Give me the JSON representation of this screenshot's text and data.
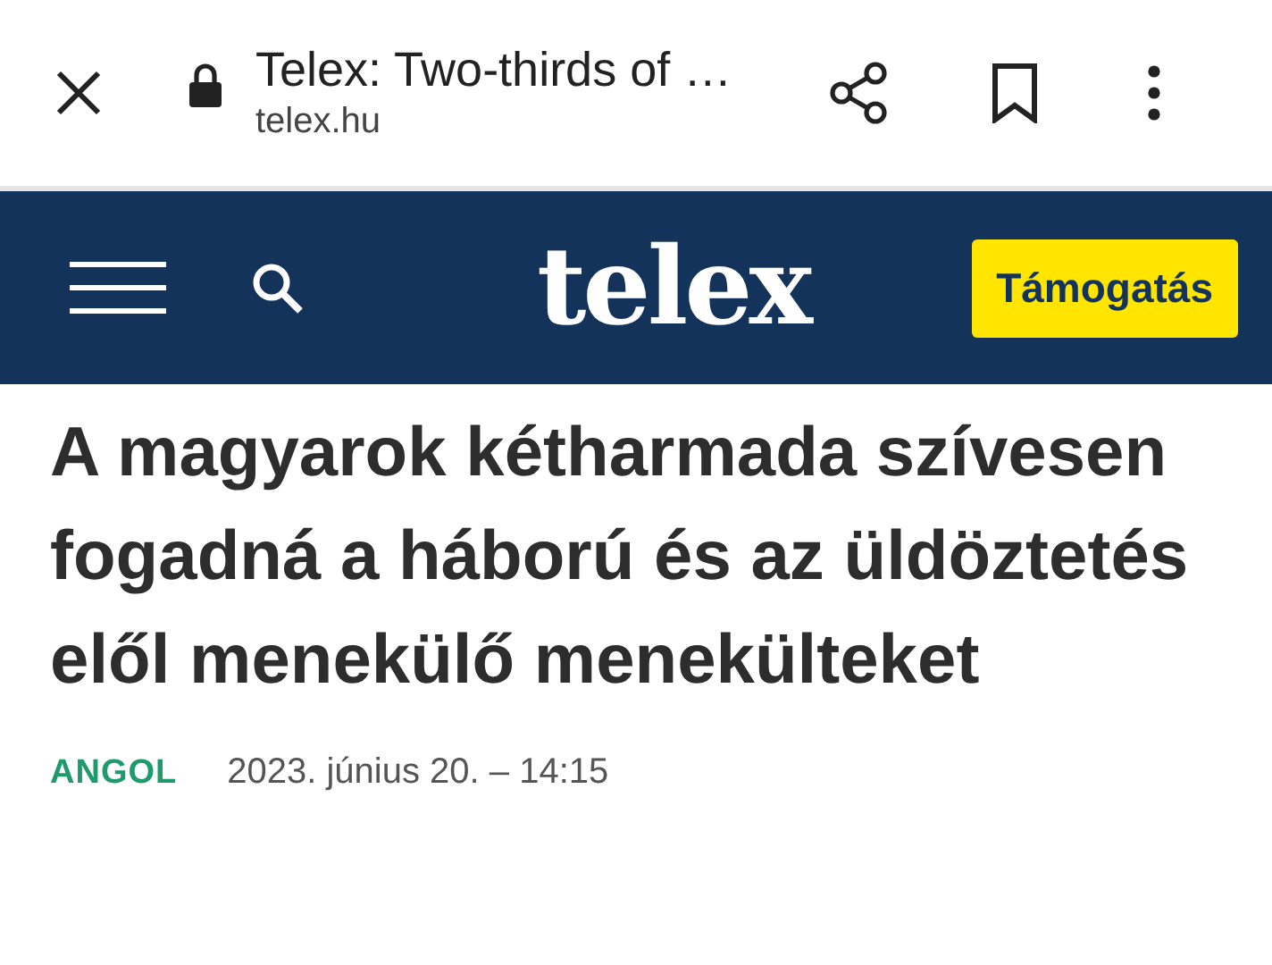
{
  "browser_bar": {
    "title": "Telex: Two-thirds of …",
    "url": "telex.hu"
  },
  "site_header": {
    "logo": "telex",
    "support_button": "Támogatás"
  },
  "article": {
    "headline": "A magyarok kétharmada szívesen fogadná a háború és az üldöztetés elől menekülő menekülteket",
    "category": "ANGOL",
    "date": "2023. június 20. – 14:15"
  }
}
